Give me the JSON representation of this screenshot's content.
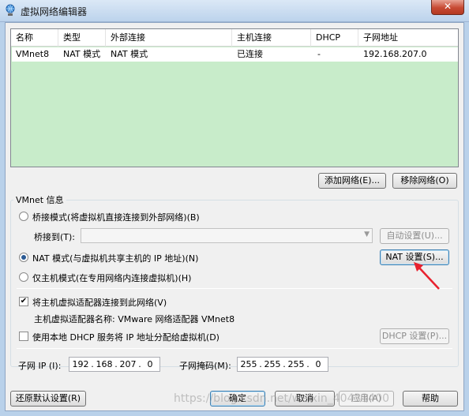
{
  "window": {
    "title": "虚拟网络编辑器",
    "close_symbol": "✕"
  },
  "network_table": {
    "headers": [
      "名称",
      "类型",
      "外部连接",
      "主机连接",
      "DHCP",
      "子网地址"
    ],
    "rows": [
      {
        "name": "VMnet8",
        "type": "NAT 模式",
        "external": "NAT 模式",
        "host": "已连接",
        "dhcp": "-",
        "subnet": "192.168.207.0"
      }
    ]
  },
  "buttons": {
    "add_network": "添加网络(E)...",
    "remove_network": "移除网络(O)",
    "auto_settings": "自动设置(U)...",
    "nat_settings": "NAT 设置(S)...",
    "dhcp_settings": "DHCP 设置(P)...",
    "restore_defaults": "还原默认设置(R)",
    "ok": "确定",
    "cancel": "取消",
    "apply": "应用(A)",
    "help": "帮助"
  },
  "vmnet_info": {
    "title": "VMnet 信息",
    "bridged_label": "桥接模式(将虚拟机直接连接到外部网络)(B)",
    "bridged_to_label": "桥接到(T):",
    "bridged_to_value": "",
    "nat_label": "NAT 模式(与虚拟机共享主机的 IP 地址)(N)",
    "hostonly_label": "仅主机模式(在专用网络内连接虚拟机)(H)",
    "selected_mode": "nat",
    "connect_adapter_label": "将主机虚拟适配器连接到此网络(V)",
    "connect_adapter_checked": true,
    "adapter_name_label": "主机虚拟适配器名称: VMware 网络适配器 VMnet8",
    "use_dhcp_label": "使用本地 DHCP 服务将 IP 地址分配给虚拟机(D)",
    "use_dhcp_checked": false,
    "subnet_ip_label": "子网 IP (I):",
    "subnet_ip": [
      "192",
      "168",
      "207",
      "0"
    ],
    "subnet_mask_label": "子网掩码(M):",
    "subnet_mask": [
      "255",
      "255",
      "255",
      "0"
    ]
  },
  "watermark": "https://blog.csdn.net/weixin_40433400",
  "colors": {
    "table_bg": "#c8ecca",
    "annotation_arrow": "#e8212e"
  }
}
